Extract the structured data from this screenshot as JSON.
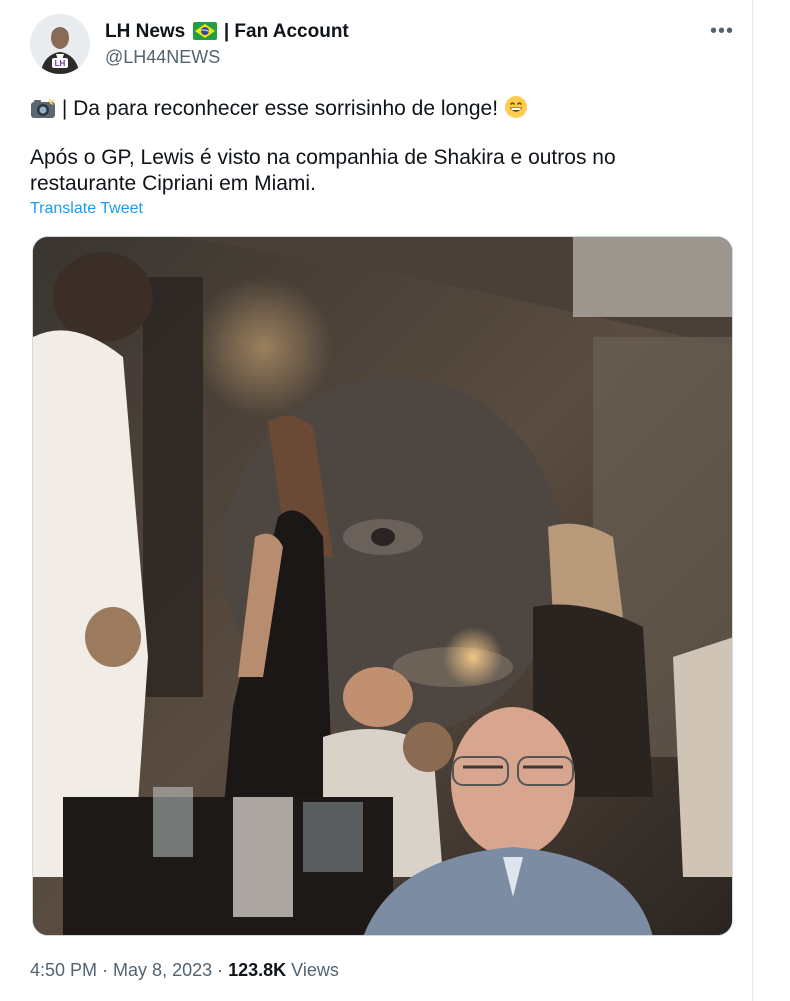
{
  "author": {
    "name_prefix": "LH News",
    "name_suffix": "| Fan Account",
    "handle": "@LH44NEWS",
    "flag_icon": "brazil-flag-icon",
    "avatar_monogram": "LH"
  },
  "more_label": "•••",
  "tweet": {
    "line1": "| Da para reconhecer esse sorrisinho de longe!",
    "line1_prefix_icon": "camera-flash-icon",
    "line1_suffix_icon": "grinning-face-icon",
    "line2": "Após o GP, Lewis é visto na companhia de Shakira e outros no",
    "line3": "restaurante Cipriani em Miami.",
    "translate_label": "Translate Tweet"
  },
  "meta": {
    "time": "4:50 PM",
    "sep1": " · ",
    "date": "May 8, 2023",
    "sep2": " · ",
    "views_count": "123.8K",
    "views_label": " Views"
  },
  "colors": {
    "accent": "#1d9bf0",
    "secondary_text": "#536471",
    "primary_text": "#0f1419"
  }
}
